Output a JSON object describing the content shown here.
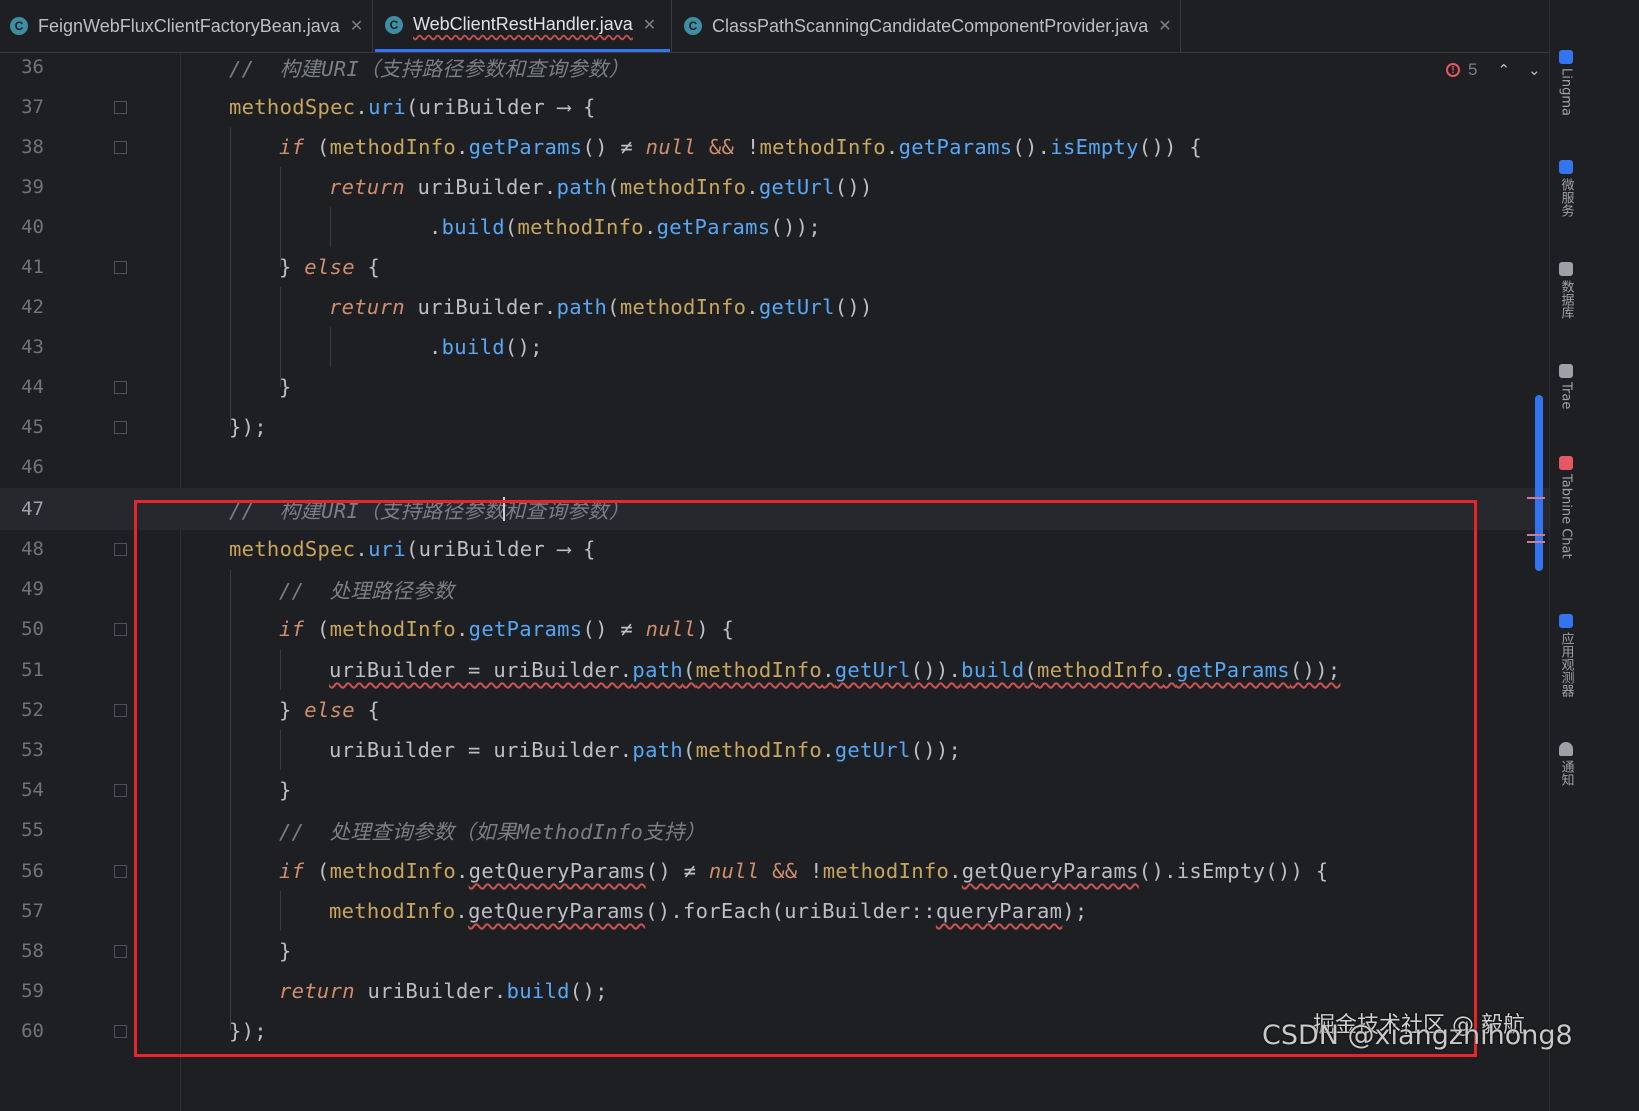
{
  "tabs": [
    {
      "label": "FeignWebFluxClientFactoryBean.java",
      "icon": "C",
      "active": false
    },
    {
      "label": "WebClientRestHandler.java",
      "icon": "C",
      "active": true
    },
    {
      "label": "ClassPathScanningCandidateComponentProvider.java",
      "icon": "C",
      "active": false
    }
  ],
  "inspection": {
    "error_count": "5"
  },
  "line_numbers": [
    "36",
    "37",
    "38",
    "39",
    "40",
    "41",
    "42",
    "43",
    "44",
    "45",
    "46",
    "47",
    "48",
    "49",
    "50",
    "51",
    "52",
    "53",
    "54",
    "55",
    "56",
    "57",
    "58",
    "59",
    "60"
  ],
  "comments": {
    "c36": "//  构建URI（支持路径参数和查询参数）",
    "c47": "//  构建URI（支持路径参数和查询参数）",
    "c49": "//  处理路径参数",
    "c55": "//  处理查询参数（如果MethodInfo支持）"
  },
  "tool_window_labels": [
    "Lingma",
    "微服务",
    "数据库",
    "Trae",
    "Tabnine Chat",
    "应用观测器",
    "通知"
  ],
  "watermarks": {
    "platform": "掘金技术社区 @ 毅航",
    "csdn": "CSDN @xiangzhihong8"
  },
  "colors": {
    "accent": "#3574f0",
    "highlight_box": "#e8252b",
    "keyword": "#cf8e6d",
    "method": "#56a8f5",
    "field": "#c7a65d",
    "error": "#c75450"
  }
}
